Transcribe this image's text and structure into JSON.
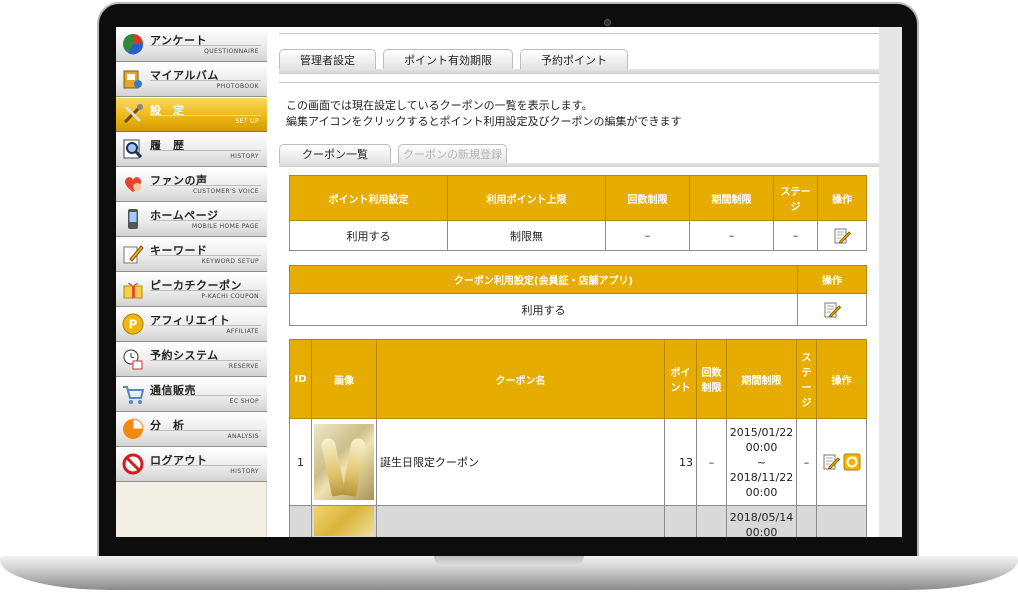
{
  "sidebar": {
    "items": [
      {
        "label": "アンケート",
        "sub": "QUESTIONNAIRE",
        "icon": "pie-chart-icon",
        "active": false
      },
      {
        "label": "マイアルバム",
        "sub": "PHOTOBOOK",
        "icon": "photobook-icon",
        "active": false
      },
      {
        "label": "設　定",
        "sub": "SET UP",
        "icon": "tools-icon",
        "active": true
      },
      {
        "label": "履　歴",
        "sub": "HISTORY",
        "icon": "magnifier-document-icon",
        "active": false
      },
      {
        "label": "ファンの声",
        "sub": "CUSTOMER'S VOICE",
        "icon": "heart-person-icon",
        "active": false
      },
      {
        "label": "ホームページ",
        "sub": "MOBILE HOME PAGE",
        "icon": "mobile-phone-icon",
        "active": false
      },
      {
        "label": "キーワード",
        "sub": "KEYWORD SETUP",
        "icon": "pencil-note-icon",
        "active": false
      },
      {
        "label": "ピーカチクーポン",
        "sub": "P-KACHI COUPON",
        "icon": "gift-icon",
        "active": false
      },
      {
        "label": "アフィリエイト",
        "sub": "AFFILIATE",
        "icon": "p-coin-icon",
        "active": false
      },
      {
        "label": "予約システム",
        "sub": "RESERVE",
        "icon": "clock-calendar-icon",
        "active": false
      },
      {
        "label": "通信販売",
        "sub": "EC SHOP",
        "icon": "shopping-cart-icon",
        "active": false
      },
      {
        "label": "分　析",
        "sub": "ANALYSIS",
        "icon": "analysis-pie-icon",
        "active": false
      },
      {
        "label": "ログアウト",
        "sub": "HISTORY",
        "icon": "no-entry-icon",
        "active": false
      }
    ]
  },
  "tabs": [
    "管理者設定",
    "ポイント有効期限",
    "予約ポイント"
  ],
  "description": {
    "line1": "この画面では現在設定しているクーポンの一覧を表示します。",
    "line2": "編集アイコンをクリックするとポイント利用設定及びクーポンの編集ができます"
  },
  "subtabs": {
    "list": "クーポン一覧",
    "new": "クーポンの新規登録"
  },
  "point_table": {
    "headers": [
      "ポイント利用設定",
      "利用ポイント上限",
      "回数制限",
      "期間制限",
      "ステージ",
      "操作"
    ],
    "row": [
      "利用する",
      "制限無",
      "–",
      "–",
      "–"
    ]
  },
  "member_table": {
    "headers": [
      "クーポン利用設定(会員証・店舗アプリ)",
      "操作"
    ],
    "row": [
      "利用する"
    ]
  },
  "coupon_table": {
    "headers": [
      "ID",
      "画像",
      "クーポン名",
      "ポイント",
      "回数制限",
      "期間制限",
      "ステージ",
      "操作"
    ],
    "rows": [
      {
        "id": "1",
        "name": "誕生日限定クーポン",
        "points": "13",
        "count": "–",
        "period": [
          "2015/01/22",
          "00:00",
          "~",
          "2018/11/22",
          "00:00"
        ],
        "stage": "–"
      },
      {
        "id": "",
        "name": "",
        "points": "",
        "count": "",
        "period": [
          "2018/05/14",
          "00:00"
        ],
        "stage": ""
      }
    ]
  },
  "colors": {
    "accent": "#e6ad00",
    "active_menu": "#eab512"
  }
}
